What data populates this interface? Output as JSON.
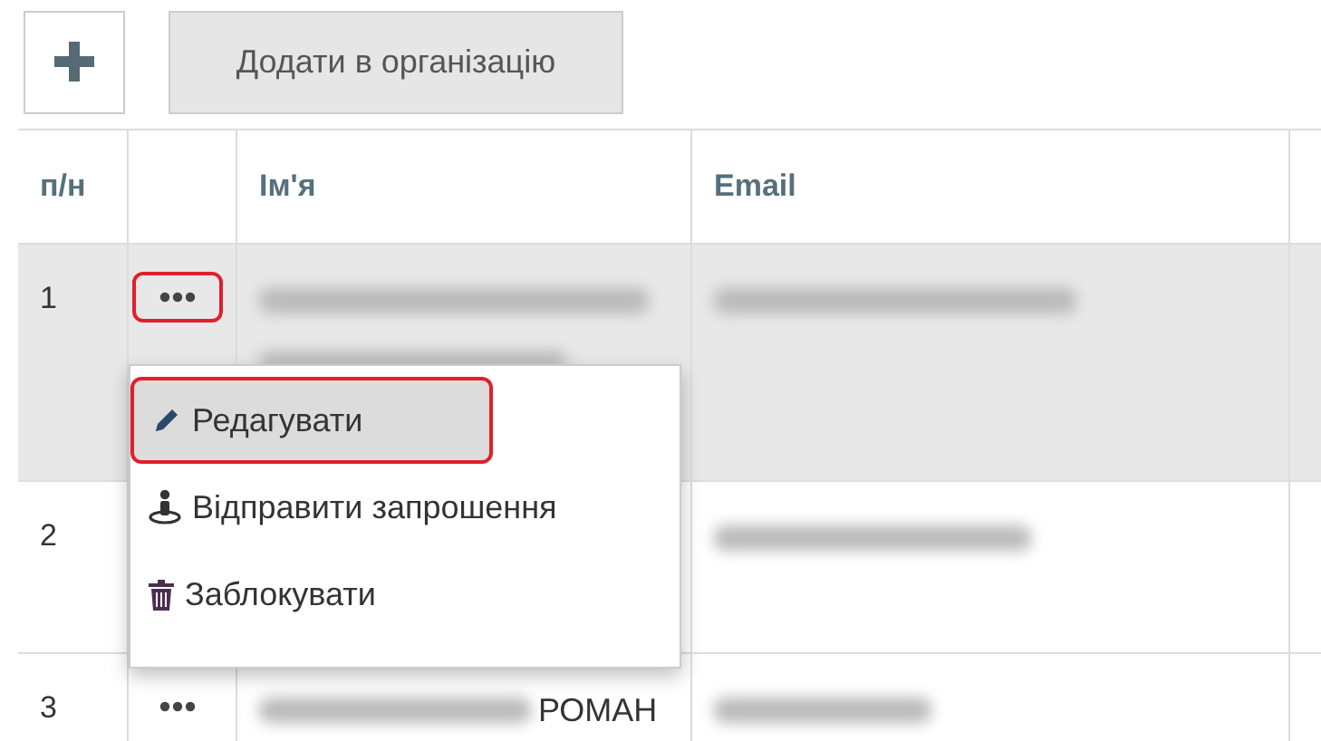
{
  "toolbar": {
    "add_button": {
      "label": "Додати в організацію"
    }
  },
  "table": {
    "columns": [
      "п/н",
      "Ім'я",
      "Email"
    ],
    "rows": [
      {
        "number": "1",
        "selected": true,
        "menu_open": true
      },
      {
        "number": "2",
        "selected": false,
        "menu_open": false
      },
      {
        "number": "3",
        "selected": false,
        "menu_open": false,
        "name": "РОМАН"
      }
    ]
  },
  "context_menu": {
    "items": [
      {
        "kind": "edit",
        "label": "Редагувати",
        "selected": true
      },
      {
        "kind": "invite",
        "label": "Відправити запрошення",
        "selected": false
      },
      {
        "kind": "block",
        "label": "Заблокувати",
        "selected": false
      }
    ]
  }
}
